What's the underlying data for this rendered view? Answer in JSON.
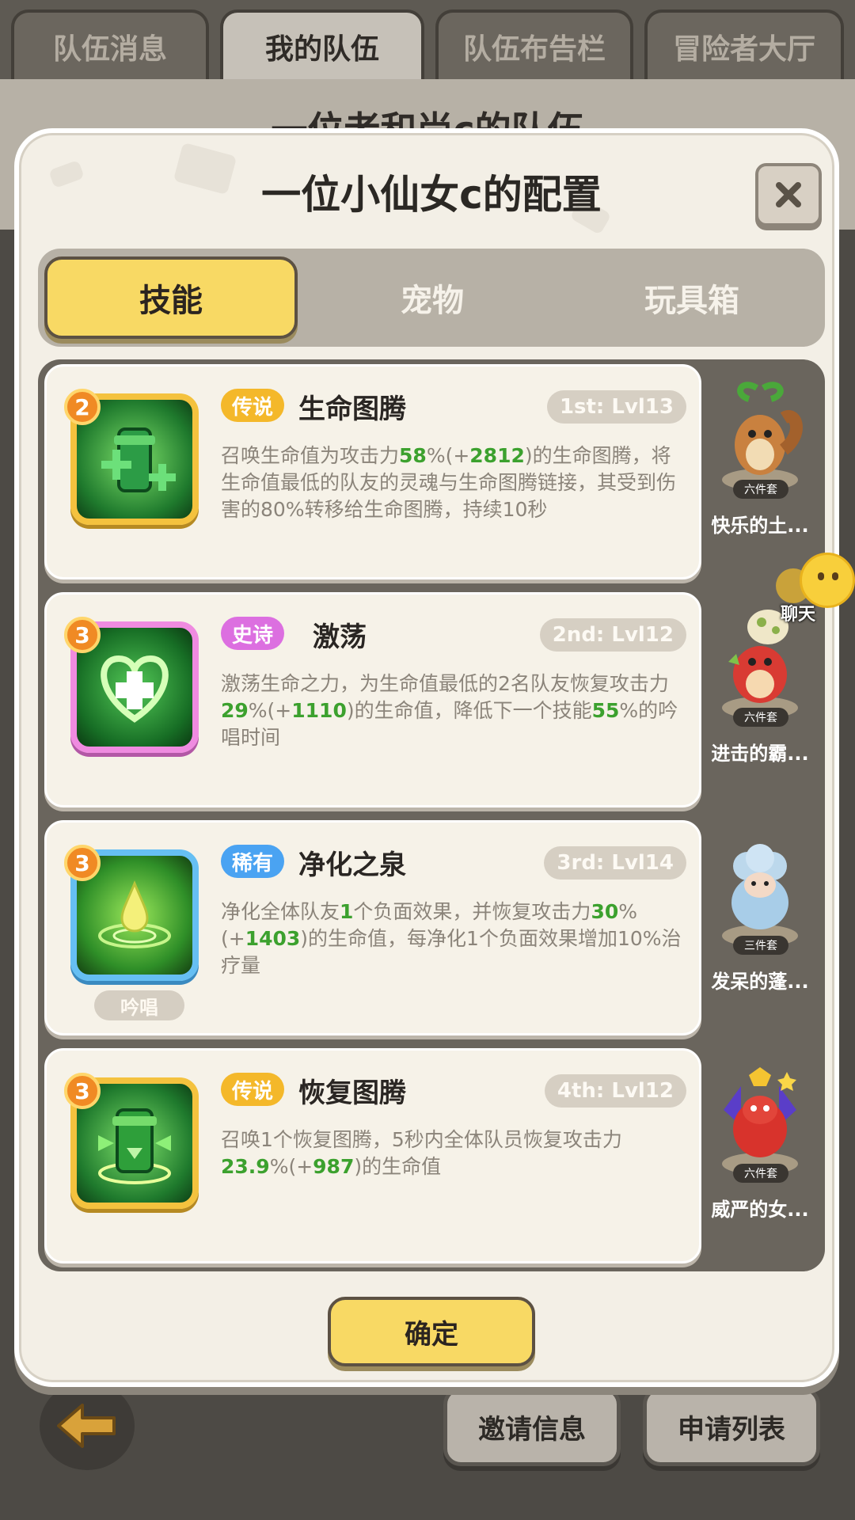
{
  "top_tabs": [
    "队伍消息",
    "我的队伍",
    "队伍布告栏",
    "冒险者大厅"
  ],
  "active_top_tab": 1,
  "page_title": "一位老和尚c的队伍",
  "modal": {
    "title": "一位小仙女c的配置",
    "close_icon": "close-icon",
    "tabs": [
      "技能",
      "宠物",
      "玩具箱"
    ],
    "active_tab": 0,
    "confirm_label": "确定"
  },
  "skills": [
    {
      "level": "2",
      "rarity": "传说",
      "rarity_color": "#f4b82a",
      "name": "生命图腾",
      "slot_level": "1st: Lvl13",
      "desc": [
        {
          "t": "召唤生命值为攻击力"
        },
        {
          "t": "58",
          "hl": true
        },
        {
          "t": "%(+"
        },
        {
          "t": "2812",
          "hl": true
        },
        {
          "t": ")的生命图腾，将生命值最低的队友的灵魂与生命图腾链接，其受到伤害的80%转移给生命图腾，持续10秒"
        }
      ],
      "icon": "totem-life-icon",
      "pet": {
        "name": "快乐的土...",
        "set": "六件套",
        "icon": "squirrel-pet-icon"
      }
    },
    {
      "level": "3",
      "rarity": "史诗",
      "rarity_color": "#dc6fe0",
      "name": "激荡",
      "slot_level": "2nd: Lvl12",
      "desc": [
        {
          "t": "激荡生命之力，为生命值最低的2名队友恢复攻击力"
        },
        {
          "t": "29",
          "hl": true
        },
        {
          "t": "%(+"
        },
        {
          "t": "1110",
          "hl": true
        },
        {
          "t": ")的生命值，降低下一个技能"
        },
        {
          "t": "55",
          "hl": true
        },
        {
          "t": "%的吟唱时间"
        }
      ],
      "icon": "heart-heal-icon",
      "pet": {
        "name": "进击的霸...",
        "set": "六件套",
        "icon": "red-dino-pet-icon"
      }
    },
    {
      "level": "3",
      "rarity": "稀有",
      "rarity_color": "#4aa3f2",
      "name": "净化之泉",
      "slot_level": "3rd: Lvl14",
      "desc": [
        {
          "t": "净化全体队友"
        },
        {
          "t": "1",
          "hl": true
        },
        {
          "t": "个负面效果，并恢复攻击力"
        },
        {
          "t": "30",
          "hl": true
        },
        {
          "t": "%(+"
        },
        {
          "t": "1403",
          "hl": true
        },
        {
          "t": ")的生命值，每净化1个负面效果增加10%治疗量"
        }
      ],
      "chant": "吟唱",
      "icon": "spring-drop-icon",
      "pet": {
        "name": "发呆的蓬...",
        "set": "三件套",
        "icon": "sheep-pet-icon"
      }
    },
    {
      "level": "3",
      "rarity": "传说",
      "rarity_color": "#f4b82a",
      "name": "恢复图腾",
      "slot_level": "4th: Lvl12",
      "desc": [
        {
          "t": "召唤1个恢复图腾，5秒内全体队员恢复攻击力"
        },
        {
          "t": "23.9",
          "hl": true
        },
        {
          "t": "%(+"
        },
        {
          "t": "987",
          "hl": true
        },
        {
          "t": ")的生命值"
        }
      ],
      "icon": "totem-recovery-icon",
      "pet": {
        "name": "威严的女...",
        "set": "六件套",
        "icon": "dragon-pet-icon"
      }
    }
  ],
  "chat": {
    "label": "聊天"
  },
  "bottom": {
    "invite_label": "邀请信息",
    "apply_label": "申请列表",
    "back_icon": "back-arrow-icon"
  }
}
